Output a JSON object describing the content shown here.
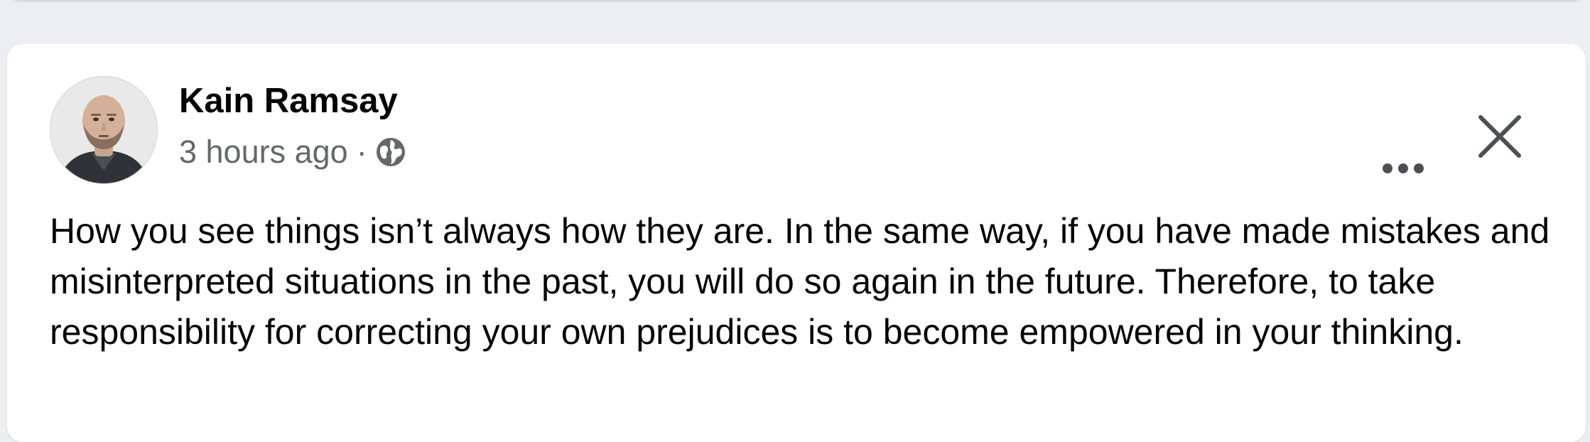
{
  "post": {
    "author": "Kain Ramsay",
    "timestamp": "3 hours ago",
    "separator": "·",
    "audience_icon": "globe-icon",
    "text": "How you see things isn’t always how they are. In the same way, if you have made mistakes and misinterpreted situations in the past, you will do so again in the future. Therefore, to take responsibility for correcting your own prejudices is to become empowered in your thinking.",
    "more_icon": "more-options-icon",
    "close_icon": "close-icon"
  },
  "colors": {
    "page_background": "#eceef1",
    "card_background": "#ffffff",
    "primary_text": "#050505",
    "secondary_text": "#65676b",
    "icon_color": "#4b4f56"
  }
}
